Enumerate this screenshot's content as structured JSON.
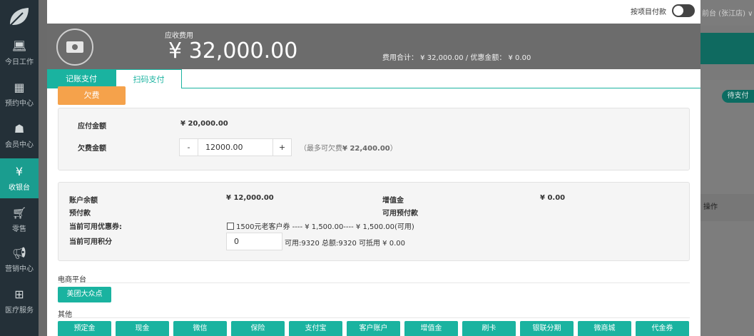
{
  "sidebar": {
    "items": [
      {
        "icon": "laptop-icon",
        "label": "今日工作",
        "active": false
      },
      {
        "icon": "calendar-icon",
        "label": "预约中心",
        "active": false
      },
      {
        "icon": "users-icon",
        "label": "会员中心",
        "active": false
      },
      {
        "icon": "yen-icon",
        "label": "收银台",
        "active": true
      },
      {
        "icon": "cart-icon",
        "label": "零售",
        "active": false
      },
      {
        "icon": "megaphone-icon",
        "label": "营销中心",
        "active": false
      },
      {
        "icon": "medical-kit-icon",
        "label": "医疗服务",
        "active": false
      }
    ]
  },
  "background": {
    "store": "前台 (张江店) ∨",
    "pending_badge": "待支付",
    "ops_header": "操作"
  },
  "modal": {
    "toggle_label": "按项目付款",
    "header": {
      "label": "应收费用",
      "amount": "¥ 32,000.00",
      "summary": "费用合计： ¥ 32,000.00 / 优惠金额： ¥ 0.00"
    },
    "tabs": [
      {
        "label": "记账支付",
        "active": true
      },
      {
        "label": "扫码支付",
        "active": false
      }
    ],
    "debt_button": "欠费",
    "debt_box": {
      "payable_label": "应付金额",
      "payable_value": "¥ 20,000.00",
      "debt_label": "欠费金额",
      "minus": "-",
      "plus": "+",
      "debt_value": "12000.00",
      "hint_prefix": "（最多可欠费",
      "hint_amount": "¥ 22,400.00",
      "hint_suffix": "）"
    },
    "account_box": {
      "balance_label": "账户余额",
      "balance_value": "¥ 12,000.00",
      "prepay_label": "预付款",
      "value_added_label": "增值金",
      "value_added_value": "¥ 0.00",
      "available_prepay_label": "可用预付款",
      "coupon_label": "当前可用优惠券:",
      "coupon_text": "1500元老客户券 ---- ¥ 1,500.00---- ¥ 1,500.00(可用)",
      "points_label": "当前可用积分",
      "points_value": "0",
      "points_info": "可用:9320 总额:9320 可抵用 ¥ 0.00"
    },
    "ecommerce": {
      "title": "电商平台",
      "button": "美团大众点"
    },
    "other": {
      "title": "其他",
      "buttons": [
        "预定金",
        "现金",
        "微信",
        "保险",
        "支付宝",
        "客户账户",
        "增值金",
        "刷卡",
        "银联分期",
        "微商城",
        "代金券"
      ]
    }
  }
}
